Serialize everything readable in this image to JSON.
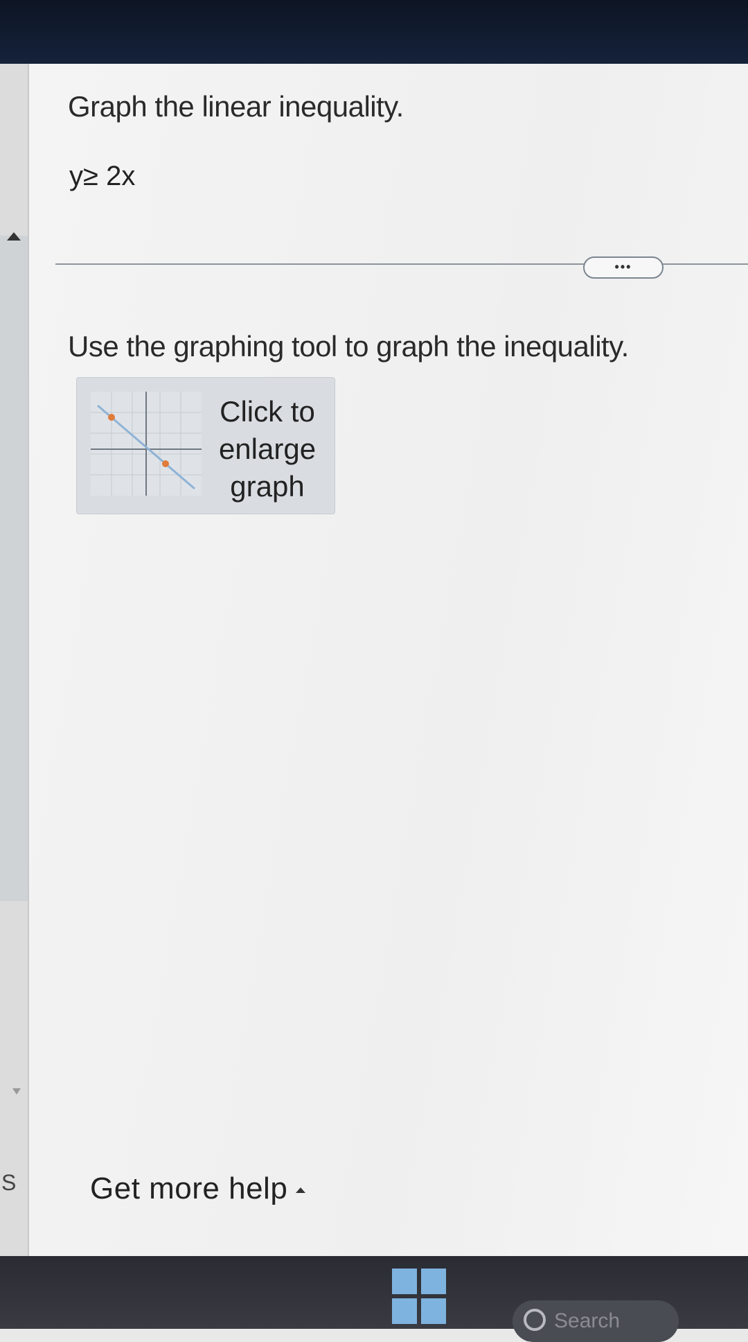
{
  "question": {
    "title": "Graph the linear inequality.",
    "equation": "y≥ 2x"
  },
  "toolbar": {
    "more_label": "•••"
  },
  "task": {
    "instruction": "Use the graphing tool to graph the inequality."
  },
  "graph_card": {
    "line1": "Click to",
    "line2": "enlarge",
    "line3": "graph"
  },
  "footer": {
    "help_label": "Get more help",
    "left_edge_letter": "S"
  },
  "taskbar": {
    "search_label": "Search"
  },
  "colors": {
    "panel_bg": "#f2f2f2",
    "graph_line": "#8fb3d6",
    "graph_point": "#e07b39"
  }
}
